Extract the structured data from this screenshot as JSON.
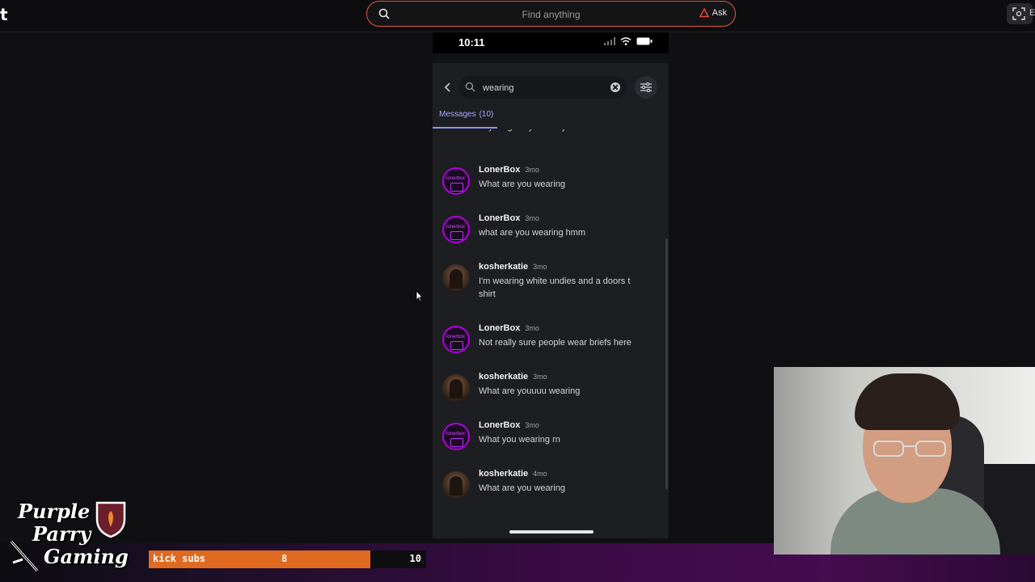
{
  "browser": {
    "search_placeholder": "Find anything",
    "ask_label": "Ask",
    "scan_label": "E"
  },
  "phone": {
    "time": "10:11",
    "search_value": "wearing",
    "tab": {
      "label": "Messages",
      "count": "(10)"
    },
    "messages": [
      {
        "author": "",
        "time": "",
        "content": "anything sexy lcl sorry",
        "avatar": "lonerbox"
      },
      {
        "author": "LonerBox",
        "time": "3mo",
        "content": "What are you wearing",
        "avatar": "lonerbox"
      },
      {
        "author": "LonerBox",
        "time": "3mo",
        "content": "what are you wearing hmm",
        "avatar": "lonerbox"
      },
      {
        "author": "kosherkatie",
        "time": "3mo",
        "content": "I'm wearing white undies and a doors t shirt",
        "avatar": "kosherkatie"
      },
      {
        "author": "LonerBox",
        "time": "3mo",
        "content": "Not really sure people wear briefs here",
        "avatar": "lonerbox"
      },
      {
        "author": "kosherkatie",
        "time": "3mo",
        "content": "What are youuuu wearing",
        "avatar": "kosherkatie"
      },
      {
        "author": "LonerBox",
        "time": "3mo",
        "content": "What you wearing rn",
        "avatar": "lonerbox"
      },
      {
        "author": "kosherkatie",
        "time": "4mo",
        "content": "What are you wearing",
        "avatar": "kosherkatie"
      }
    ],
    "avatar_text": "lonerbox"
  },
  "overlay": {
    "brand_line1": "Purple",
    "brand_line2": "Parry",
    "brand_line3": "Gaming",
    "sub_label": "kick subs",
    "sub_current": "8",
    "sub_goal": "10",
    "sub_progress": 0.8,
    "accent": "#e16a21"
  }
}
